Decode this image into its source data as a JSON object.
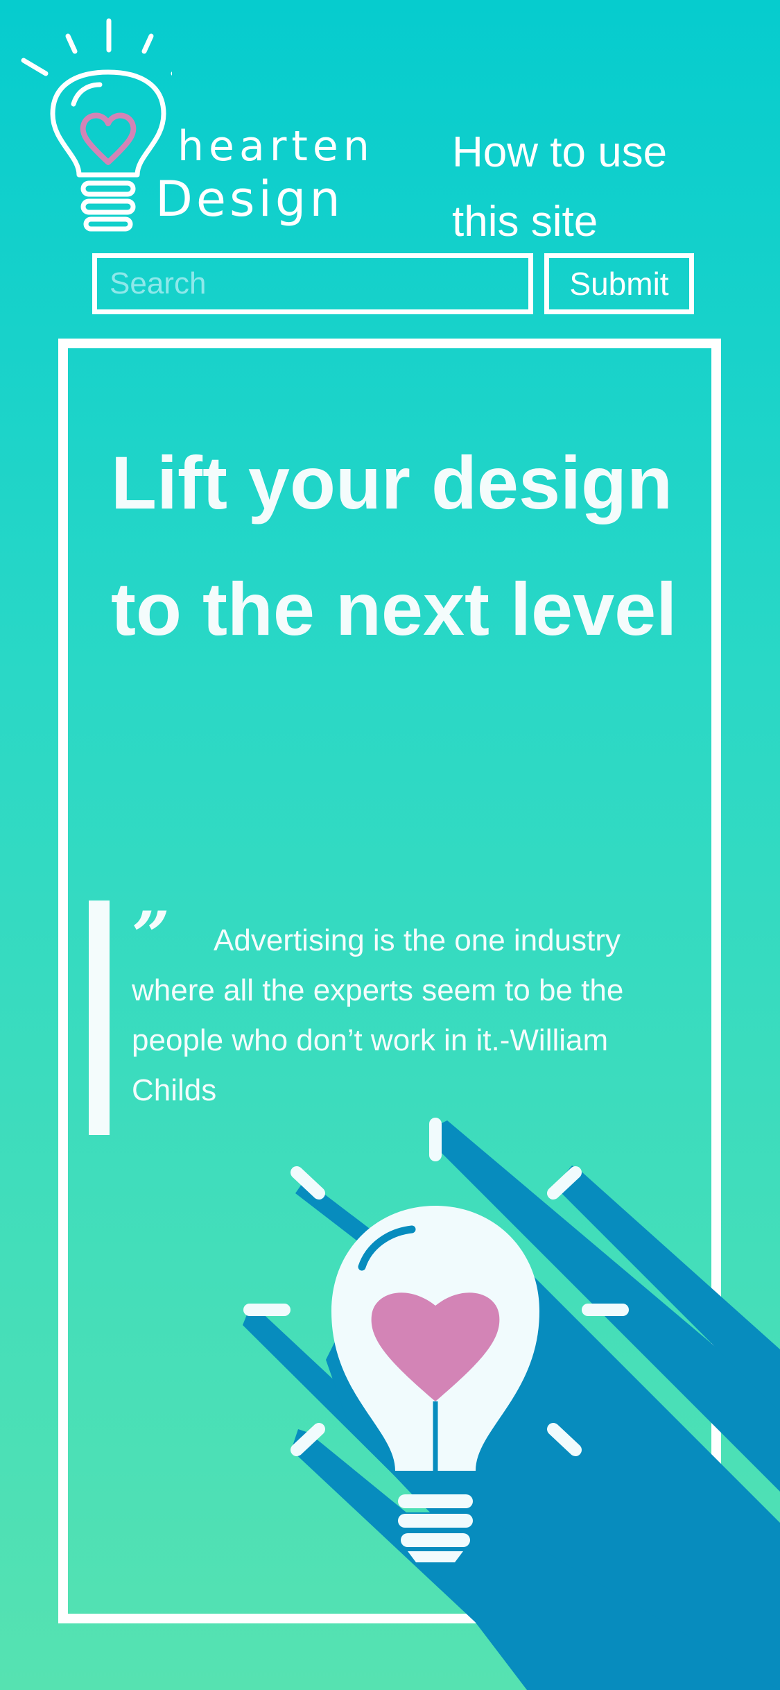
{
  "brand": {
    "line1": "hearten",
    "line2": "Design"
  },
  "nav": {
    "how_to_use": "How to use this site"
  },
  "search": {
    "placeholder": "Search",
    "value": "",
    "submit_label": "Submit"
  },
  "hero": {
    "headline": "Lift your design to the next level",
    "quote_mark": "”",
    "quote": "Advertising is the one industry where all the experts seem to be the people who don’t work in it.-William Childs"
  },
  "colors": {
    "background_top": "#06ccce",
    "background_bottom": "#56e2b1",
    "shadow": "#078cbe",
    "heart": "#d384b6",
    "bulb": "#f1fbfd"
  },
  "icons": {
    "logo": "lightbulb-heart-icon",
    "illustration": "lightbulb-heart-icon"
  }
}
